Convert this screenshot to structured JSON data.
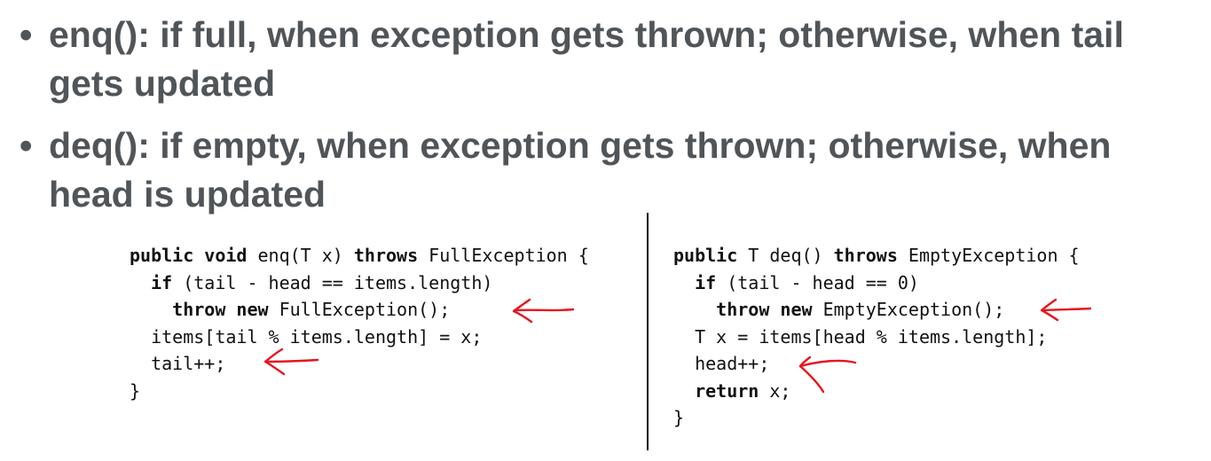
{
  "bullets": [
    {
      "marker": "•",
      "text": "enq(): if full, when exception gets thrown; otherwise, when tail gets updated"
    },
    {
      "marker": "•",
      "text": "deq(): if empty, when exception gets thrown; otherwise, when head is updated"
    }
  ],
  "code_left": {
    "l1_kw": "public void",
    "l1_mid": " enq(T x) ",
    "l1_kw2": "throws",
    "l1_rest": " FullException {",
    "l2_kw": "if",
    "l2_rest": " (tail - head == items.length)",
    "l3_kw": "throw new",
    "l3_rest": " FullException();",
    "l4": "items[tail % items.length] = x;",
    "l5": "tail++;",
    "l6": "}"
  },
  "code_right": {
    "l1_kw": "public",
    "l1_mid": " T deq() ",
    "l1_kw2": "throws",
    "l1_rest": " EmptyException {",
    "l2_kw": "if",
    "l2_rest": " (tail - head == 0)",
    "l3_kw": "throw new",
    "l3_rest": " EmptyException();",
    "l4": "T x = items[head % items.length];",
    "l5": "head++;",
    "l6_kw": "return",
    "l6_rest": " x;",
    "l7": "}"
  },
  "colors": {
    "bullet_text": "#505559",
    "code_text": "#111111",
    "annotation": "#e8141e"
  },
  "icons": [
    "red-arrow-icon"
  ]
}
